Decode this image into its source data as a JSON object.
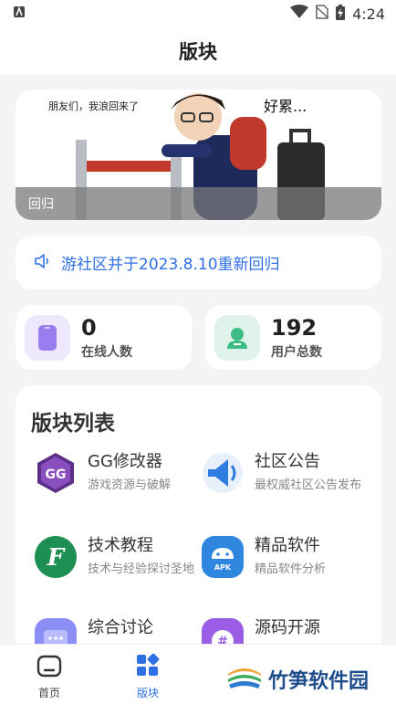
{
  "status": {
    "time": "4:24"
  },
  "header": {
    "title": "版块"
  },
  "banner": {
    "caption": "回归",
    "speech_left": "朋友们，我浪回来了",
    "speech_right": "好累..."
  },
  "notice": {
    "text": "游社区并于2023.8.10重新回归"
  },
  "stats": [
    {
      "value": "0",
      "label": "在线人数"
    },
    {
      "value": "192",
      "label": "用户总数"
    }
  ],
  "section": {
    "title": "版块列表",
    "boards": [
      {
        "name": "GG修改器",
        "desc": "游戏资源与破解"
      },
      {
        "name": "社区公告",
        "desc": "最权威社区公告发布"
      },
      {
        "name": "技术教程",
        "desc": "技术与经验探讨圣地"
      },
      {
        "name": "精品软件",
        "desc": "精品软件分析"
      },
      {
        "name": "综合讨论",
        "desc": ""
      },
      {
        "name": "源码开源",
        "desc": ""
      }
    ]
  },
  "tabbar": {
    "tabs": [
      {
        "label": "首页"
      },
      {
        "label": "版块"
      }
    ]
  },
  "watermark": {
    "text": "竹笋软件园"
  },
  "colors": {
    "accent": "#2f6fe4",
    "background": "#f4f4f6"
  }
}
